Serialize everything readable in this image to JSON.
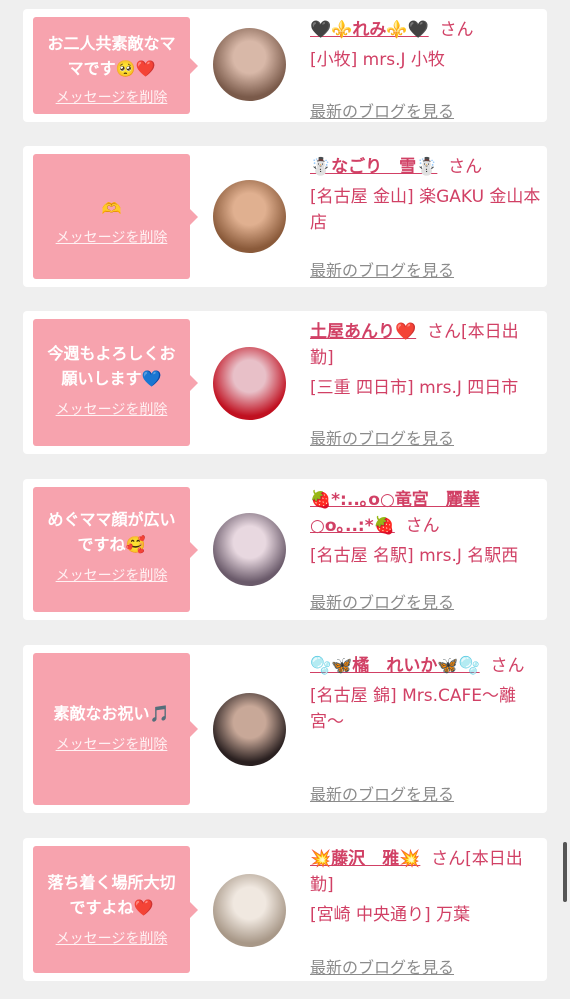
{
  "cards": [
    {
      "message": "お二人共素敵なママです🥺❤️",
      "delete_label": "メッセージを削除",
      "name": "🖤⚜️れみ⚜️🖤",
      "san": "さん",
      "shop": "[小牧] mrs.J 小牧",
      "blog_label": "最新のブログを見る",
      "avatar_colors": [
        "#7a5a4a",
        "#d8b8a8"
      ]
    },
    {
      "message": "🫶",
      "delete_label": "メッセージを削除",
      "name": "☃️なごり　雪☃️",
      "san": "さん",
      "shop": "[名古屋 金山] 楽GAKU 金山本店",
      "blog_label": "最新のブログを見る",
      "avatar_colors": [
        "#8a5a3a",
        "#e0b090"
      ]
    },
    {
      "message": "今週もよろしくお願いします💙",
      "delete_label": "メッセージを削除",
      "name": "土屋あんり❤️",
      "san": "さん[本日出勤]",
      "shop": "[三重 四日市] mrs.J 四日市",
      "blog_label": "最新のブログを見る",
      "avatar_colors": [
        "#c01020",
        "#e8c0c8"
      ]
    },
    {
      "message": "めぐママ顔が広いですね🥰",
      "delete_label": "メッセージを削除",
      "name": "🍓*:..｡o○竜宮　麗華○o｡..:*🍓",
      "san": "さん",
      "shop": "[名古屋 名駅] mrs.J 名駅西",
      "blog_label": "最新のブログを見る",
      "avatar_colors": [
        "#6a5a6a",
        "#e8d8e0"
      ]
    },
    {
      "message": "素敵なお祝い🎵",
      "delete_label": "メッセージを削除",
      "name": "🫧🦋橘　れいか🦋🫧",
      "san": "さん",
      "shop": "[名古屋 錦] Mrs.CAFE〜離宮〜",
      "blog_label": "最新のブログを見る",
      "avatar_colors": [
        "#2a2020",
        "#c8a898"
      ]
    },
    {
      "message": "落ち着く場所大切ですよね❤️",
      "delete_label": "メッセージを削除",
      "name": "💥藤沢　雅💥",
      "san": "さん[本日出勤]",
      "shop": "[宮崎 中央通り] 万葉",
      "blog_label": "最新のブログを見る",
      "avatar_colors": [
        "#a89888",
        "#f0e8e0"
      ]
    }
  ]
}
